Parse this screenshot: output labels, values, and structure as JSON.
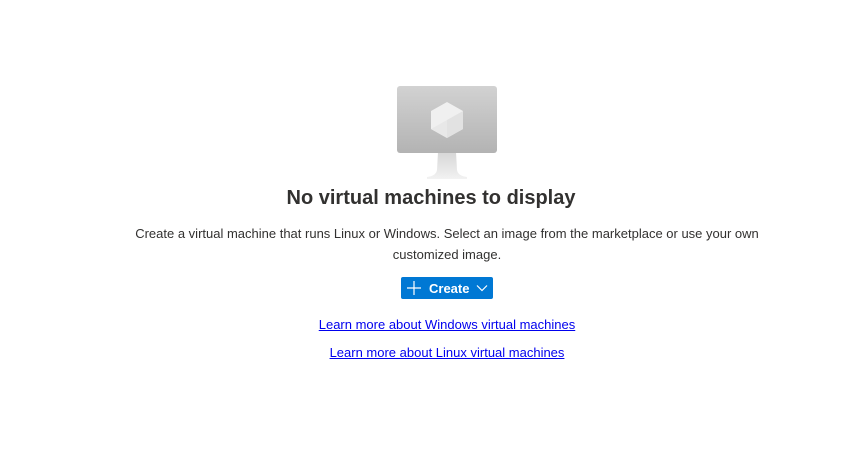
{
  "empty_state": {
    "illustration_icon": "virtual-machine-monitor-icon",
    "title": "No virtual machines to display",
    "description": "Create a virtual machine that runs Linux or Windows. Select an image from the marketplace or use your own customized image.",
    "create_button": {
      "label": "Create",
      "icon": "plus-icon",
      "dropdown_icon": "chevron-down-icon",
      "color": "#0078d4"
    },
    "links": [
      {
        "label": "Learn more about Windows virtual machines"
      },
      {
        "label": "Learn more about Linux virtual machines"
      }
    ]
  }
}
